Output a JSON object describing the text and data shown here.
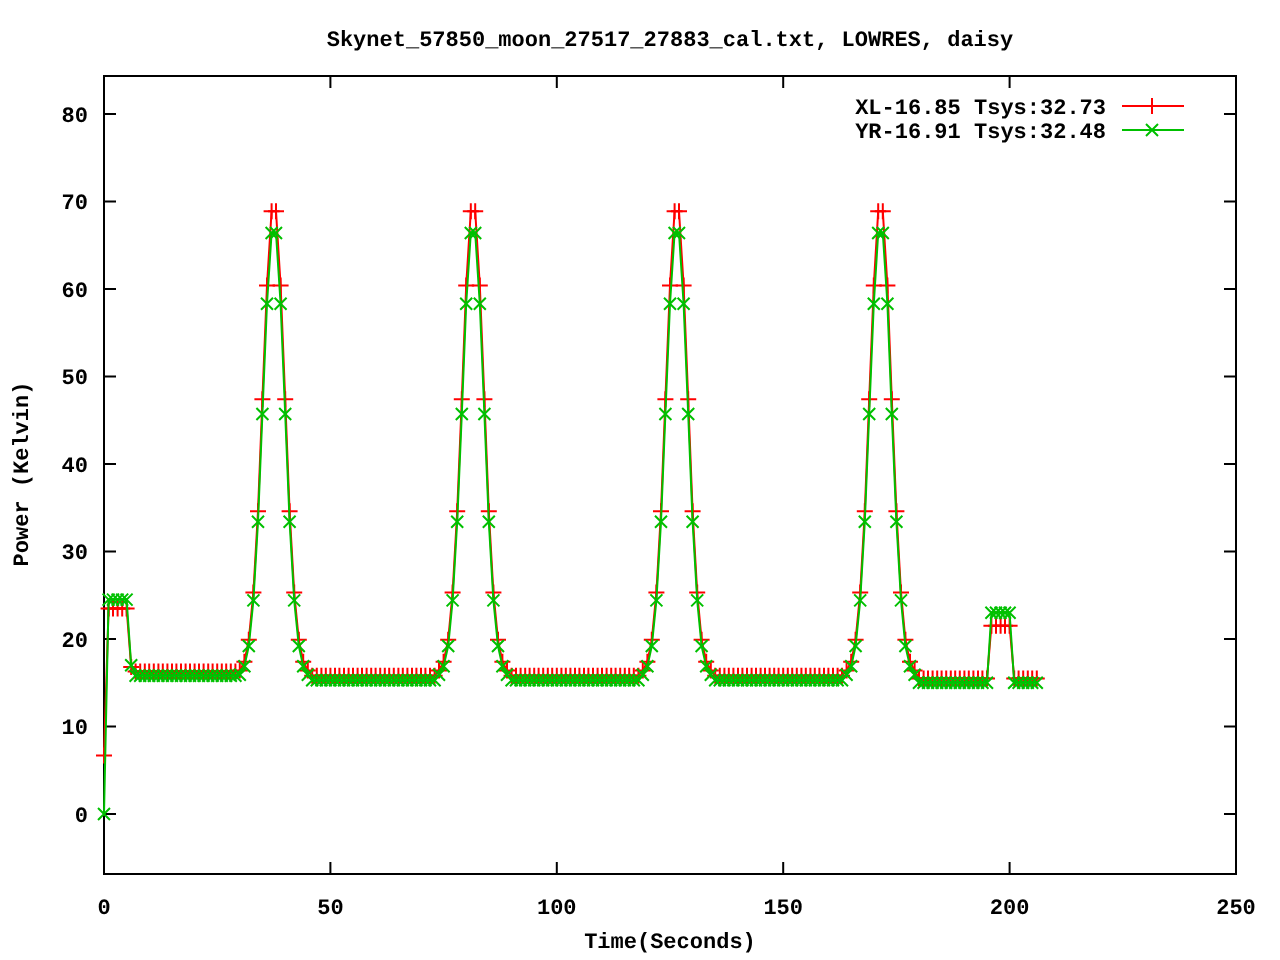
{
  "chart_data": {
    "type": "line",
    "title": "Skynet_57850_moon_27517_27883_cal.txt, LOWRES, daisy",
    "xlabel": "Time(Seconds)",
    "ylabel": "Power (Kelvin)",
    "x": [
      0,
      1,
      2,
      3,
      4,
      5,
      6,
      7,
      8,
      9,
      10,
      11,
      12,
      13,
      14,
      15,
      16,
      17,
      18,
      19,
      20,
      21,
      22,
      23,
      24,
      25,
      26,
      27,
      28,
      29,
      30,
      31,
      32,
      33,
      34,
      35,
      36,
      37,
      38,
      39,
      40,
      41,
      42,
      43,
      44,
      45,
      46,
      47,
      48,
      49,
      50,
      51,
      52,
      53,
      54,
      55,
      56,
      57,
      58,
      59,
      60,
      61,
      62,
      63,
      64,
      65,
      66,
      67,
      68,
      69,
      70,
      71,
      72,
      73,
      74,
      75,
      76,
      77,
      78,
      79,
      80,
      81,
      82,
      83,
      84,
      85,
      86,
      87,
      88,
      89,
      90,
      91,
      92,
      93,
      94,
      95,
      96,
      97,
      98,
      99,
      100,
      101,
      102,
      103,
      104,
      105,
      106,
      107,
      108,
      109,
      110,
      111,
      112,
      113,
      114,
      115,
      116,
      117,
      118,
      119,
      120,
      121,
      122,
      123,
      124,
      125,
      126,
      127,
      128,
      129,
      130,
      131,
      132,
      133,
      134,
      135,
      136,
      137,
      138,
      139,
      140,
      141,
      142,
      143,
      144,
      145,
      146,
      147,
      148,
      149,
      150,
      151,
      152,
      153,
      154,
      155,
      156,
      157,
      158,
      159,
      160,
      161,
      162,
      163,
      164,
      165,
      166,
      167,
      168,
      169,
      170,
      171,
      172,
      173,
      174,
      175,
      176,
      177,
      178,
      179,
      180,
      181,
      182,
      183,
      184,
      185,
      186,
      187,
      188,
      189,
      190,
      191,
      192,
      193,
      194,
      195,
      196,
      197,
      198,
      199,
      200,
      201,
      202,
      203,
      204,
      205,
      206
    ],
    "series": [
      {
        "name": "XL-16.85 Tsys:32.73",
        "color": "#ff0000",
        "marker": "cross",
        "values": [
          6.7,
          23.5,
          23.5,
          23.5,
          23.5,
          23.5,
          16.8,
          16.3,
          16.3,
          16.3,
          16.3,
          16.3,
          16.3,
          16.3,
          16.3,
          16.3,
          16.3,
          16.3,
          16.3,
          16.3,
          16.3,
          16.3,
          16.3,
          16.3,
          16.3,
          16.3,
          16.3,
          16.3,
          16.3,
          16.3,
          16.4,
          17.4,
          19.9,
          25.3,
          34.6,
          47.4,
          60.4,
          68.9,
          68.9,
          60.4,
          47.4,
          34.6,
          25.3,
          19.9,
          17.4,
          16.4,
          15.8,
          15.8,
          15.8,
          15.8,
          15.8,
          15.8,
          15.8,
          15.8,
          15.8,
          15.8,
          15.8,
          15.8,
          15.8,
          15.8,
          15.8,
          15.8,
          15.8,
          15.8,
          15.8,
          15.8,
          15.8,
          15.8,
          15.8,
          15.8,
          15.8,
          15.8,
          15.8,
          15.8,
          16.4,
          17.4,
          19.9,
          25.3,
          34.6,
          47.4,
          60.4,
          68.9,
          68.9,
          60.4,
          47.4,
          34.6,
          25.3,
          19.9,
          17.4,
          16.4,
          15.8,
          15.8,
          15.8,
          15.8,
          15.8,
          15.8,
          15.8,
          15.8,
          15.8,
          15.8,
          15.8,
          15.8,
          15.8,
          15.8,
          15.8,
          15.8,
          15.8,
          15.8,
          15.8,
          15.8,
          15.8,
          15.8,
          15.8,
          15.8,
          15.8,
          15.8,
          15.8,
          15.8,
          15.8,
          16.4,
          17.4,
          19.9,
          25.3,
          34.6,
          47.4,
          60.4,
          68.9,
          68.9,
          60.4,
          47.4,
          34.6,
          25.3,
          19.9,
          17.4,
          16.4,
          15.8,
          15.8,
          15.8,
          15.8,
          15.8,
          15.8,
          15.8,
          15.8,
          15.8,
          15.8,
          15.8,
          15.8,
          15.8,
          15.8,
          15.8,
          15.8,
          15.8,
          15.8,
          15.8,
          15.8,
          15.8,
          15.8,
          15.8,
          15.8,
          15.8,
          15.8,
          15.8,
          15.8,
          15.8,
          16.4,
          17.4,
          19.9,
          25.3,
          34.6,
          47.4,
          60.4,
          68.9,
          68.9,
          60.4,
          47.4,
          34.6,
          25.3,
          19.9,
          17.4,
          16.4,
          15.5,
          15.5,
          15.5,
          15.5,
          15.5,
          15.5,
          15.5,
          15.5,
          15.5,
          15.5,
          15.5,
          15.5,
          15.5,
          15.5,
          15.5,
          15.5,
          21.5,
          21.5,
          21.5,
          21.5,
          21.5,
          15.5,
          15.5,
          15.5,
          15.5,
          15.5,
          15.5
        ]
      },
      {
        "name": "YR-16.91 Tsys:32.48",
        "color": "#00c000",
        "marker": "x",
        "values": [
          0,
          24.5,
          24.5,
          24.5,
          24.5,
          24.5,
          17,
          15.8,
          15.8,
          15.8,
          15.8,
          15.8,
          15.8,
          15.8,
          15.8,
          15.8,
          15.8,
          15.8,
          15.8,
          15.8,
          15.8,
          15.8,
          15.8,
          15.8,
          15.8,
          15.8,
          15.8,
          15.8,
          15.8,
          15.8,
          15.9,
          16.9,
          19.2,
          24.4,
          33.4,
          45.7,
          58.3,
          66.4,
          66.4,
          58.3,
          45.7,
          33.4,
          24.4,
          19.2,
          16.9,
          15.9,
          15.3,
          15.3,
          15.3,
          15.3,
          15.3,
          15.3,
          15.3,
          15.3,
          15.3,
          15.3,
          15.3,
          15.3,
          15.3,
          15.3,
          15.3,
          15.3,
          15.3,
          15.3,
          15.3,
          15.3,
          15.3,
          15.3,
          15.3,
          15.3,
          15.3,
          15.3,
          15.3,
          15.3,
          15.9,
          16.9,
          19.2,
          24.4,
          33.4,
          45.7,
          58.3,
          66.4,
          66.4,
          58.3,
          45.7,
          33.4,
          24.4,
          19.2,
          16.9,
          15.9,
          15.3,
          15.3,
          15.3,
          15.3,
          15.3,
          15.3,
          15.3,
          15.3,
          15.3,
          15.3,
          15.3,
          15.3,
          15.3,
          15.3,
          15.3,
          15.3,
          15.3,
          15.3,
          15.3,
          15.3,
          15.3,
          15.3,
          15.3,
          15.3,
          15.3,
          15.3,
          15.3,
          15.3,
          15.3,
          15.9,
          16.9,
          19.2,
          24.4,
          33.4,
          45.7,
          58.3,
          66.4,
          66.4,
          58.3,
          45.7,
          33.4,
          24.4,
          19.2,
          16.9,
          15.9,
          15.3,
          15.3,
          15.3,
          15.3,
          15.3,
          15.3,
          15.3,
          15.3,
          15.3,
          15.3,
          15.3,
          15.3,
          15.3,
          15.3,
          15.3,
          15.3,
          15.3,
          15.3,
          15.3,
          15.3,
          15.3,
          15.3,
          15.3,
          15.3,
          15.3,
          15.3,
          15.3,
          15.3,
          15.3,
          15.9,
          16.9,
          19.2,
          24.4,
          33.4,
          45.7,
          58.3,
          66.4,
          66.4,
          58.3,
          45.7,
          33.4,
          24.4,
          19.2,
          16.9,
          15.9,
          15,
          15,
          15,
          15,
          15,
          15,
          15,
          15,
          15,
          15,
          15,
          15,
          15,
          15,
          15,
          15,
          23,
          23,
          23,
          23,
          23,
          15,
          15,
          15,
          15,
          15,
          15
        ]
      }
    ],
    "legend": true,
    "xlim": [
      0,
      250
    ],
    "ylim": [
      -6.86,
      84.34
    ],
    "xticks": [
      0,
      50,
      100,
      150,
      200,
      250
    ],
    "yticks": [
      0,
      10,
      20,
      30,
      40,
      50,
      60,
      70,
      80
    ]
  }
}
